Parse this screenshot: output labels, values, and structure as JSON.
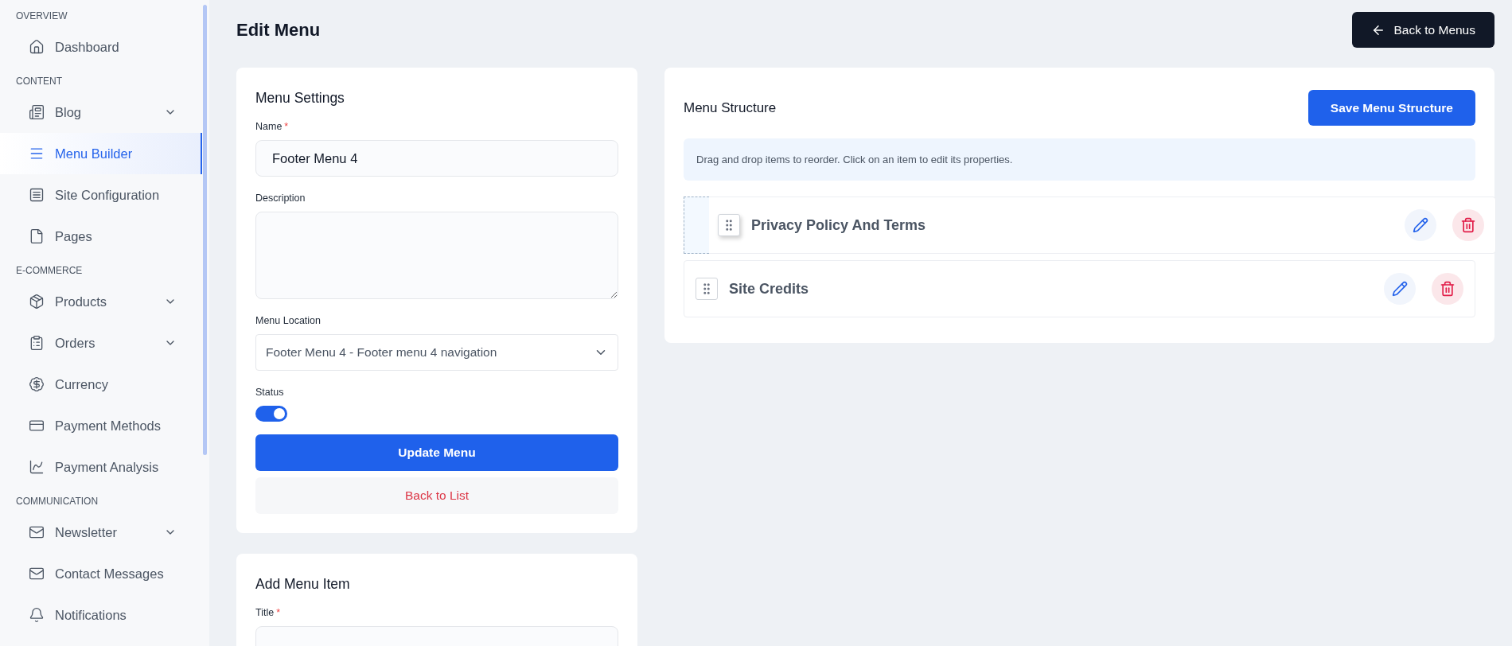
{
  "sidebar": {
    "sections": [
      {
        "title": "OVERVIEW",
        "items": [
          {
            "label": "Dashboard",
            "selected": false,
            "has_submenu": false
          }
        ]
      },
      {
        "title": "CONTENT",
        "items": [
          {
            "label": "Blog",
            "selected": false,
            "has_submenu": true
          },
          {
            "label": "Menu Builder",
            "selected": true,
            "has_submenu": false
          },
          {
            "label": "Site Configuration",
            "selected": false,
            "has_submenu": false
          },
          {
            "label": "Pages",
            "selected": false,
            "has_submenu": false
          }
        ]
      },
      {
        "title": "E-COMMERCE",
        "items": [
          {
            "label": "Products",
            "selected": false,
            "has_submenu": true
          },
          {
            "label": "Orders",
            "selected": false,
            "has_submenu": true
          },
          {
            "label": "Currency",
            "selected": false,
            "has_submenu": false
          },
          {
            "label": "Payment Methods",
            "selected": false,
            "has_submenu": false
          },
          {
            "label": "Payment Analysis",
            "selected": false,
            "has_submenu": false
          }
        ]
      },
      {
        "title": "COMMUNICATION",
        "items": [
          {
            "label": "Newsletter",
            "selected": false,
            "has_submenu": true
          },
          {
            "label": "Contact Messages",
            "selected": false,
            "has_submenu": false
          },
          {
            "label": "Notifications",
            "selected": false,
            "has_submenu": false
          }
        ]
      }
    ]
  },
  "page": {
    "title": "Edit Menu",
    "back_button": "Back to Menus"
  },
  "menu_settings": {
    "title": "Menu Settings",
    "name": {
      "label": "Name",
      "required_mark": "*",
      "value": "Footer Menu 4"
    },
    "description": {
      "label": "Description"
    },
    "location": {
      "label": "Menu Location",
      "value": "Footer Menu 4 - Footer menu 4 navigation"
    },
    "status": {
      "label": "Status",
      "on": true
    },
    "update_button": "Update Menu",
    "back_button": "Back to List"
  },
  "add_menu_item": {
    "title": "Add Menu Item",
    "title_field": {
      "label": "Title",
      "required_mark": "*"
    }
  },
  "menu_structure": {
    "title": "Menu Structure",
    "save_button": "Save Menu Structure",
    "hint": "Drag and drop items to reorder. Click on an item to edit its properties.",
    "items": [
      {
        "label": "Privacy Policy And Terms",
        "dragging": true
      },
      {
        "label": "Site Credits",
        "dragging": false
      }
    ]
  }
}
